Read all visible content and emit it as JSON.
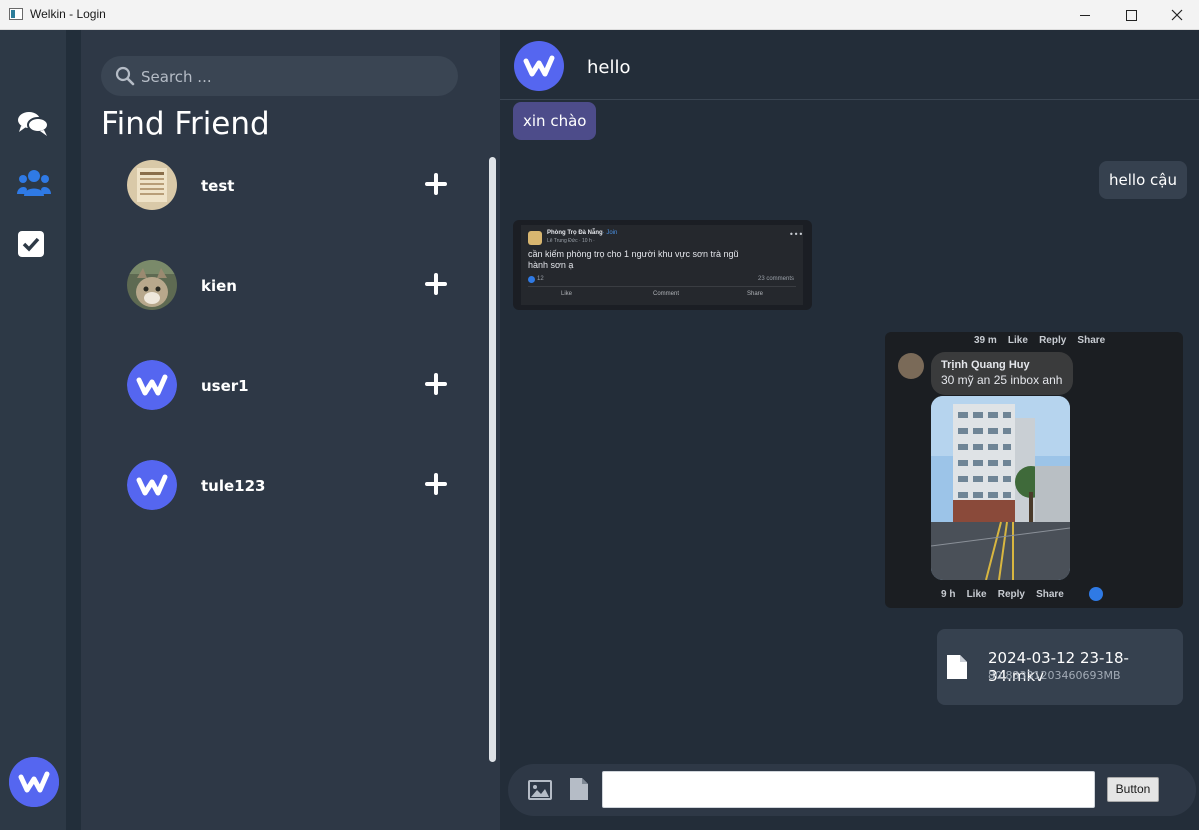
{
  "window": {
    "title": "Welkin - Login"
  },
  "sidebar": {
    "items": [
      {
        "icon": "chat-bubbles-icon"
      },
      {
        "icon": "users-icon",
        "active": true
      },
      {
        "icon": "checkbox-icon"
      }
    ],
    "brand_color": "#5566f0"
  },
  "friends": {
    "search_placeholder": "Search ...",
    "title": "Find Friend",
    "list": [
      {
        "name": "test",
        "avatar": "photo"
      },
      {
        "name": "kien",
        "avatar": "cat-photo"
      },
      {
        "name": "user1",
        "avatar": "welkin-logo"
      },
      {
        "name": "tule123",
        "avatar": "welkin-logo"
      }
    ]
  },
  "chat": {
    "contact_name": "hello",
    "messages": [
      {
        "direction": "in",
        "type": "text",
        "text": "xin chào"
      },
      {
        "direction": "out",
        "type": "text",
        "text": "hello cậu"
      },
      {
        "direction": "in",
        "type": "image",
        "content": {
          "group": "Phòng Trọ Đà Nẵng",
          "join": "· Join",
          "poster": "Lê Trung Đức · 10 h ·",
          "body": "cần kiếm phòng trọ cho 1 người khu vực sơn trà ngũ hành sơn ạ",
          "reactions": "12",
          "comments": "23 comments",
          "actions": [
            "Like",
            "Comment",
            "Share"
          ]
        }
      },
      {
        "direction": "out",
        "type": "image",
        "content": {
          "top_time": "39 m",
          "top_actions": [
            "Like",
            "Reply",
            "Share"
          ],
          "commenter": "Trịnh Quang Huy",
          "comment": "30 mỹ an 25 inbox anh",
          "bottom_time": "9 h",
          "bottom_actions": [
            "Like",
            "Reply",
            "Share"
          ]
        }
      },
      {
        "direction": "out",
        "type": "file",
        "filename": "2024-03-12 23-18-34.mkv",
        "size": "80.83331203460693MB"
      }
    ]
  },
  "composer": {
    "send_label": "Button"
  },
  "colors": {
    "incoming_bubble": "#4d4c8a",
    "outgoing_bubble": "#36414f",
    "accent_blue": "#2f7ae5"
  }
}
